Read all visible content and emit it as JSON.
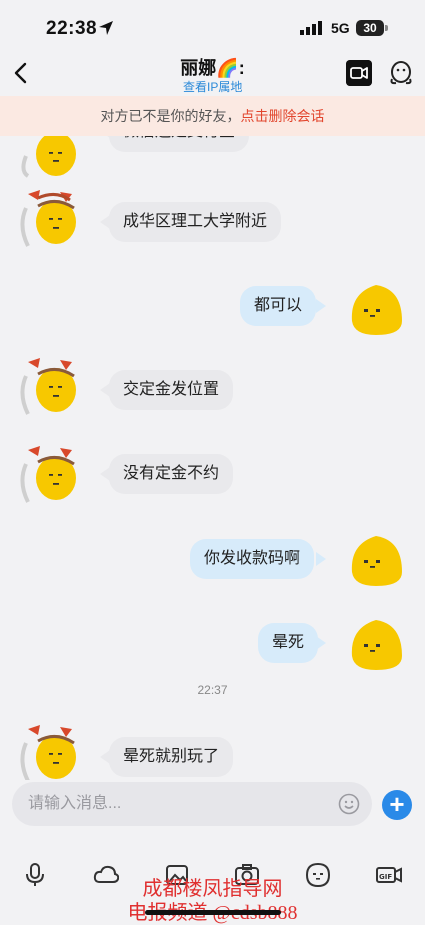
{
  "status": {
    "time": "22:38",
    "network": "5G",
    "battery": "30"
  },
  "header": {
    "title": "丽娜🌈:",
    "subtitle": "查看IP属地"
  },
  "banner": {
    "text": "对方已不是你的好友，",
    "link": "点击删除会话"
  },
  "messages": [
    {
      "side": "left",
      "text": "微信还是支付宝"
    },
    {
      "side": "left",
      "text": "成华区理工大学附近"
    },
    {
      "side": "right",
      "text": "都可以"
    },
    {
      "side": "left",
      "text": "交定金发位置"
    },
    {
      "side": "left",
      "text": "没有定金不约"
    },
    {
      "side": "right",
      "text": "你发收款码啊"
    },
    {
      "side": "right",
      "text": "晕死"
    },
    {
      "side": "left",
      "text": "晕死就别玩了"
    }
  ],
  "timestamp": "22:37",
  "input": {
    "placeholder": "请输入消息..."
  },
  "toolbar": [
    "mic-icon",
    "cloud-icon",
    "image-icon",
    "camera-icon",
    "sticker-icon",
    "gif-icon"
  ],
  "watermark": {
    "line1": "成都楼凤指导网",
    "line2": "电报频道 @cdsb888"
  },
  "colors": {
    "accent": "#2a89d8",
    "banner_bg": "#fbe9e2",
    "banner_link": "#e2462e",
    "right_bubble": "#d7ebfa",
    "left_bubble": "#e9e9ec"
  }
}
